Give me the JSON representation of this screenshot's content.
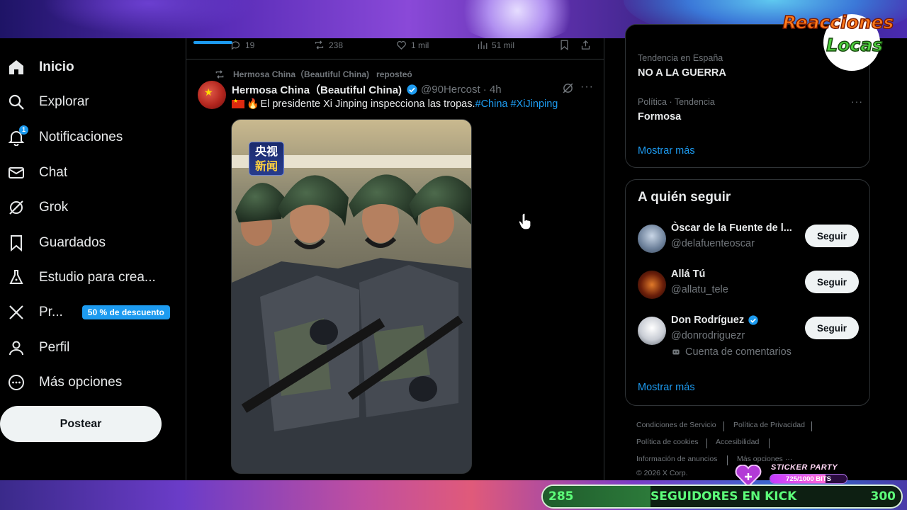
{
  "sidebar": {
    "items": [
      {
        "label": "Inicio",
        "icon": "home-icon"
      },
      {
        "label": "Explorar",
        "icon": "search-icon"
      },
      {
        "label": "Notificaciones",
        "icon": "bell-icon",
        "badge": "1"
      },
      {
        "label": "Chat",
        "icon": "mail-icon"
      },
      {
        "label": "Grok",
        "icon": "grok-icon"
      },
      {
        "label": "Guardados",
        "icon": "bookmark-icon"
      },
      {
        "label": "Estudio para crea...",
        "icon": "flask-icon"
      },
      {
        "label": "Pr...",
        "icon": "x-logo-icon",
        "promo": "50 % de descuento"
      },
      {
        "label": "Perfil",
        "icon": "person-icon"
      },
      {
        "label": "Más opciones",
        "icon": "more-circle-icon"
      }
    ],
    "post_button": "Postear"
  },
  "timeline": {
    "action_bar": {
      "replies": "19",
      "reposts": "238",
      "likes": "1 mil",
      "views": "51 mil"
    },
    "post": {
      "repost_by": "Hermosa China（Beautiful China)",
      "reposted_label": "reposteó",
      "author": "Hermosa China（Beautiful China)",
      "handle_time": "@90Hercost · 4h",
      "text": "El presidente Xi Jinping inspecciona las tropas.",
      "hashtags": [
        "#China",
        "#XiJinping"
      ],
      "media_logo": [
        "央视",
        "新闻"
      ]
    }
  },
  "right": {
    "trends": [
      {
        "meta": "Tendencia en España",
        "name": "NO A LA GUERRA"
      },
      {
        "meta": "Política · Tendencia",
        "name": "Formosa"
      }
    ],
    "trends_show_more": "Mostrar más",
    "follow_title": "A quién seguir",
    "follow": [
      {
        "name": "Òscar de la Fuente de l...",
        "handle": "@delafuenteoscar",
        "verified": false,
        "button": "Seguir"
      },
      {
        "name": "Allá Tú",
        "handle": "@allatu_tele",
        "verified": false,
        "button": "Seguir"
      },
      {
        "name": "Don Rodríguez",
        "handle": "@donrodriguezr",
        "verified": true,
        "extra": "Cuenta de comentarios",
        "button": "Seguir"
      }
    ],
    "follow_show_more": "Mostrar más",
    "footer": {
      "links": [
        "Condiciones de Servicio",
        "Política de Privacidad",
        "Política de cookies",
        "Accesibilidad",
        "Información de anuncios",
        "Más opciones ···"
      ],
      "copyright": "© 2026 X Corp."
    }
  },
  "overlay": {
    "logo_line1": "Reacciones",
    "logo_line2": "Locas",
    "sticker_title": "STICKER PARTY",
    "sticker_value": "725/1000 BITS",
    "sticker_progress": 0.725,
    "goal_start": "285",
    "goal_label": "SEGUIDORES EN KICK",
    "goal_end": "300",
    "goal_progress": 0.3
  },
  "colors": {
    "accent": "#1d9bf0",
    "text": "#e7e9ea",
    "muted": "#71767b",
    "border": "#2f3336"
  }
}
